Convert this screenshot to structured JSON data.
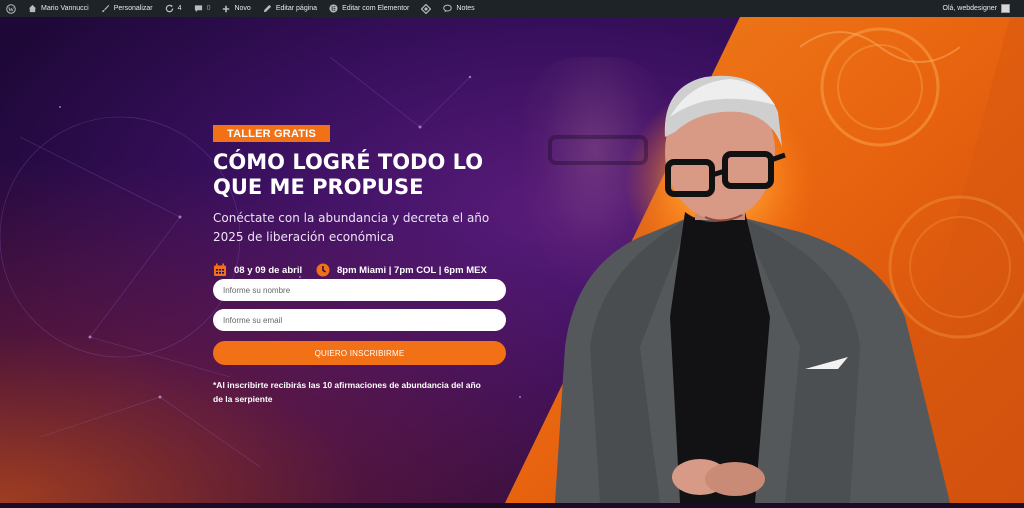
{
  "adminbar": {
    "site_name": "Mario Vannucci",
    "customize": "Personalizar",
    "updates_count": "4",
    "comments_count": "0",
    "new": "Novo",
    "edit_page": "Editar página",
    "edit_elementor": "Editar com Elementor",
    "notes": "Notes",
    "greeting": "Olá, webdesigner"
  },
  "hero": {
    "badge": "TALLER GRATIS",
    "title_line1": "CÓMO LOGRÉ TODO LO",
    "title_line2": "QUE ME PROPUSE",
    "subtitle_line1": "Conéctate con la abundancia y decreta el año",
    "subtitle_line2": "2025 de liberación económica",
    "date": "08 y 09 de abril",
    "time": "8pm Miami | 7pm COL | 6pm MEX",
    "name_placeholder": "Informe su nombre",
    "email_placeholder": "Informe su email",
    "submit_label": "QUIERO INSCRIBIRME",
    "note_line1": "*Al inscribirte recibirás las 10 afirmaciones de abundancia del año",
    "note_line2": "de la serpiente"
  },
  "colors": {
    "accent": "#f27116",
    "admin_bar": "#1d2327",
    "background": "#2a0d44"
  },
  "icons": [
    "wordpress-icon",
    "home-icon",
    "brush-icon",
    "refresh-icon",
    "comment-icon",
    "plus-icon",
    "pencil-icon",
    "elementor-icon",
    "diamond-icon",
    "speech-bubble-icon",
    "calendar-icon",
    "clock-icon"
  ]
}
